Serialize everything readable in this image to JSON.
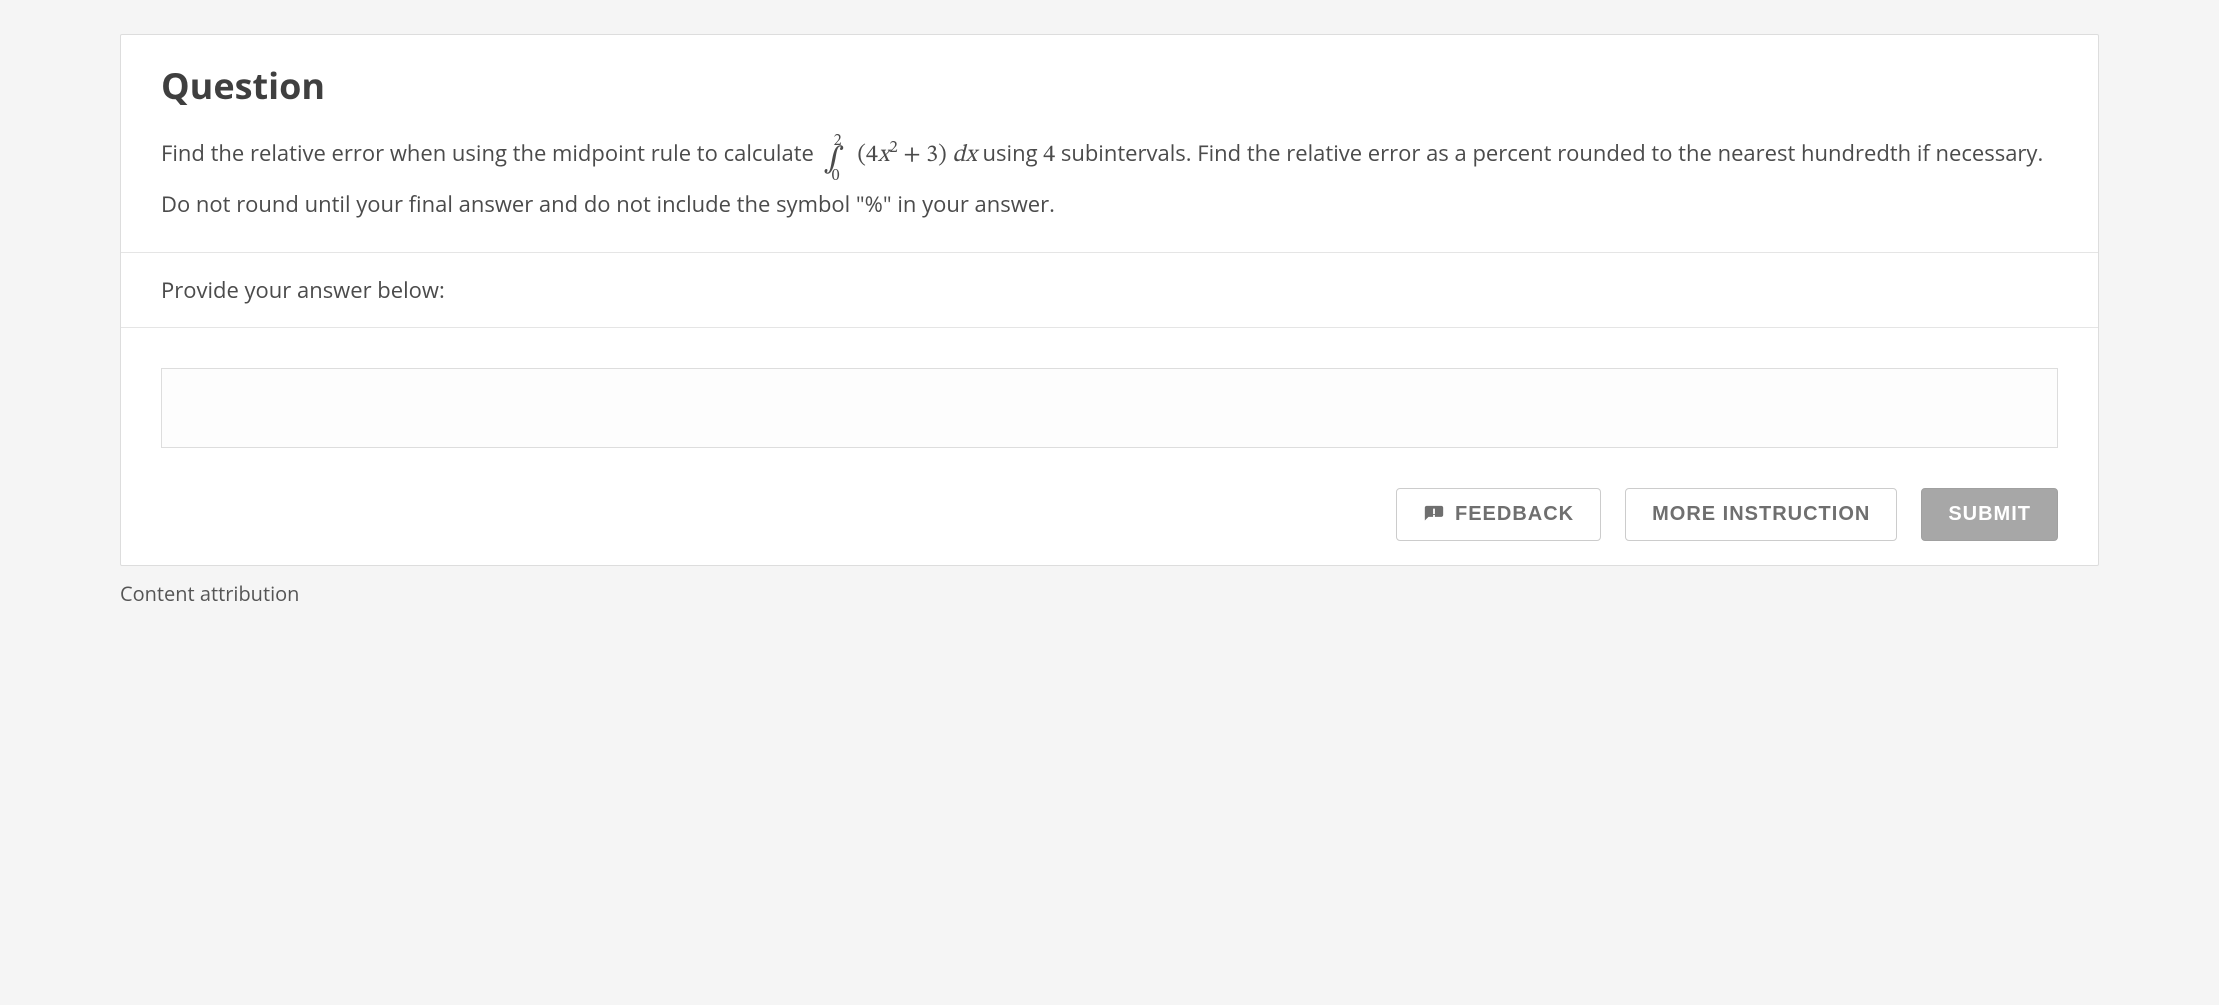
{
  "question": {
    "heading": "Question",
    "prefix_text": "Find the relative error when using the midpoint rule to calculate ",
    "integral": {
      "lower": "0",
      "upper": "2",
      "coef": "4",
      "var1": "x",
      "exp": "2",
      "plus_const": "3",
      "dvar": "x"
    },
    "mid_text_before_subintervals": " using ",
    "subintervals": "4",
    "mid_text_after_subintervals": " subintervals. Find the relative error as a percent rounded to the nearest hundredth if necessary. Do not round until your final answer and do not include the symbol \"%\" in your answer."
  },
  "prompt": "Provide your answer below:",
  "answer": {
    "value": "",
    "placeholder": ""
  },
  "buttons": {
    "feedback": "FEEDBACK",
    "more_instruction": "MORE INSTRUCTION",
    "submit": "SUBMIT"
  },
  "attribution": "Content attribution"
}
